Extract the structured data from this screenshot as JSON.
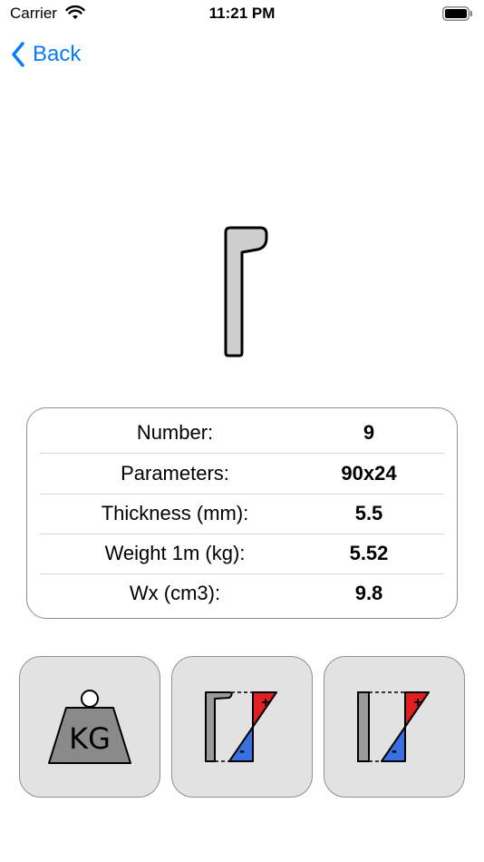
{
  "status_bar": {
    "carrier": "Carrier",
    "time": "11:21 PM"
  },
  "nav": {
    "back_label": "Back"
  },
  "profile": {
    "icon": "channel-profile-icon",
    "fill": "#cfcfcf"
  },
  "table": {
    "rows": [
      {
        "label": "Number:",
        "value": "9"
      },
      {
        "label": "Parameters:",
        "value": "90x24"
      },
      {
        "label": "Thickness (mm):",
        "value": "5.5"
      },
      {
        "label": "Weight 1m (kg):",
        "value": "5.52"
      },
      {
        "label": "Wx (cm3):",
        "value": "9.8"
      }
    ]
  },
  "buttons": {
    "weight": {
      "icon": "weight-kg-icon",
      "text": "KG"
    },
    "stress_profile": {
      "icon": "stress-diagram-profile-icon",
      "plus": "+",
      "minus": "-"
    },
    "stress_plate": {
      "icon": "stress-diagram-plate-icon",
      "plus": "+",
      "minus": "-"
    }
  },
  "colors": {
    "accent": "#0a7aff",
    "positive": "#e02020",
    "negative": "#3a6fe0",
    "button_bg": "#e2e2e2"
  }
}
